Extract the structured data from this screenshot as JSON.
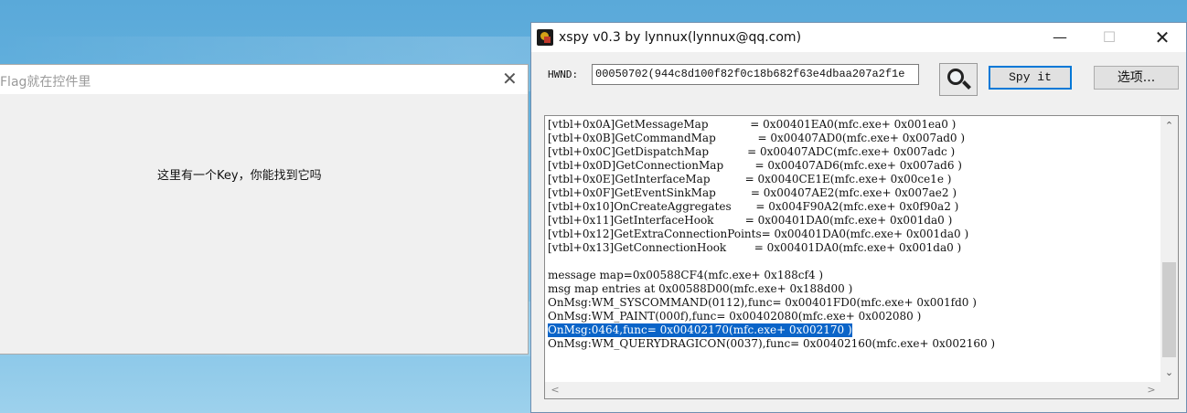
{
  "flag_window": {
    "title": "Flag就在控件里",
    "close_glyph": "✕",
    "message": "这里有一个Key，你能找到它吗"
  },
  "xspy_window": {
    "title": "xspy v0.3 by lynnux(lynnux@qq.com)",
    "controls": {
      "minimize": "—",
      "maximize": "☐",
      "close": "✕"
    },
    "hwnd_label": "HWND:",
    "hwnd_value": "00050702(944c8d100f82f0c18b682f63e4dbaa207a2f1e",
    "spy_button": "Spy it",
    "options_button": "选项...",
    "output_lines": [
      "[vtbl+0x0A]GetMessageMap            = 0x00401EA0(mfc.exe+ 0x001ea0 )",
      "[vtbl+0x0B]GetCommandMap            = 0x00407AD0(mfc.exe+ 0x007ad0 )",
      "[vtbl+0x0C]GetDispatchMap           = 0x00407ADC(mfc.exe+ 0x007adc )",
      "[vtbl+0x0D]GetConnectionMap         = 0x00407AD6(mfc.exe+ 0x007ad6 )",
      "[vtbl+0x0E]GetInterfaceMap          = 0x0040CE1E(mfc.exe+ 0x00ce1e )",
      "[vtbl+0x0F]GetEventSinkMap          = 0x00407AE2(mfc.exe+ 0x007ae2 )",
      "[vtbl+0x10]OnCreateAggregates       = 0x004F90A2(mfc.exe+ 0x0f90a2 )",
      "[vtbl+0x11]GetInterfaceHook         = 0x00401DA0(mfc.exe+ 0x001da0 )",
      "[vtbl+0x12]GetExtraConnectionPoints= 0x00401DA0(mfc.exe+ 0x001da0 )",
      "[vtbl+0x13]GetConnectionHook        = 0x00401DA0(mfc.exe+ 0x001da0 )",
      "",
      "message map=0x00588CF4(mfc.exe+ 0x188cf4 )",
      "msg map entries at 0x00588D00(mfc.exe+ 0x188d00 )",
      "OnMsg:WM_SYSCOMMAND(0112),func= 0x00401FD0(mfc.exe+ 0x001fd0 )",
      "OnMsg:WM_PAINT(000f),func= 0x00402080(mfc.exe+ 0x002080 )",
      "OnMsg:0464,func= 0x00402170(mfc.exe+ 0x002170 )",
      "OnMsg:WM_QUERYDRAGICON(0037),func= 0x00402160(mfc.exe+ 0x002160 )"
    ],
    "selected_line_index": 15,
    "scroll_glyphs": {
      "up": "⌃",
      "down": "⌄",
      "left": "<",
      "right": ">"
    }
  }
}
